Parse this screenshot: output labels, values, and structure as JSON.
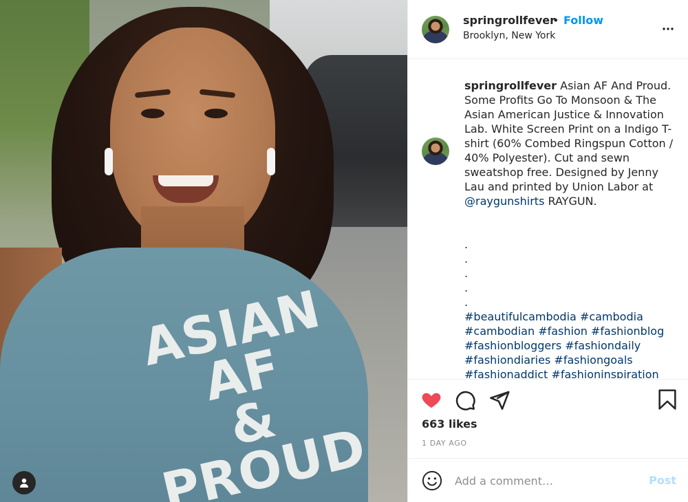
{
  "post": {
    "username": "springrollfever",
    "follow_label": "Follow",
    "separator": "•",
    "location": "Brooklyn, New York",
    "shirt_lines": [
      "ASIAN",
      "AF",
      "& PROUD"
    ],
    "caption": {
      "username": "springrollfever",
      "text_before_mention": " Asian AF And Proud. Some Profits Go To Monsoon & The Asian American Justice & Innovation Lab. White Screen Print on a Indigo T-shirt (60% Combed Ringspun Cotton / 40% Polyester). Cut and sewn sweatshop free. Designed by Jenny Lau and printed by Union Labor at ",
      "mention": "@raygunshirts",
      "text_after_mention": " RAYGUN.",
      "dots": [
        ".",
        ".",
        ".",
        ".",
        "."
      ],
      "hashtags": [
        "#beautifulcambodia",
        "#cambodia",
        "#cambodian",
        "#fashion",
        "#fashionblog",
        "#fashionbloggers",
        "#fashiondaily",
        "#fashiondiaries",
        "#fashiongoals",
        "#fashionaddict",
        "#fashioninspiration"
      ]
    },
    "likes": "663 likes",
    "time": "1 DAY AGO",
    "comment_placeholder": "Add a comment…",
    "post_label": "Post"
  },
  "icons": {
    "more": "more-options-icon",
    "like": "heart-icon",
    "comment": "comment-icon",
    "share": "share-icon",
    "save": "bookmark-icon",
    "emoji": "emoji-icon",
    "user_tag": "user-tag-icon"
  },
  "colors": {
    "like": "#ed4956",
    "follow": "#0095f6",
    "link": "#00376b",
    "post_disabled": "#b2dffc",
    "muted": "#8e8e8e"
  }
}
